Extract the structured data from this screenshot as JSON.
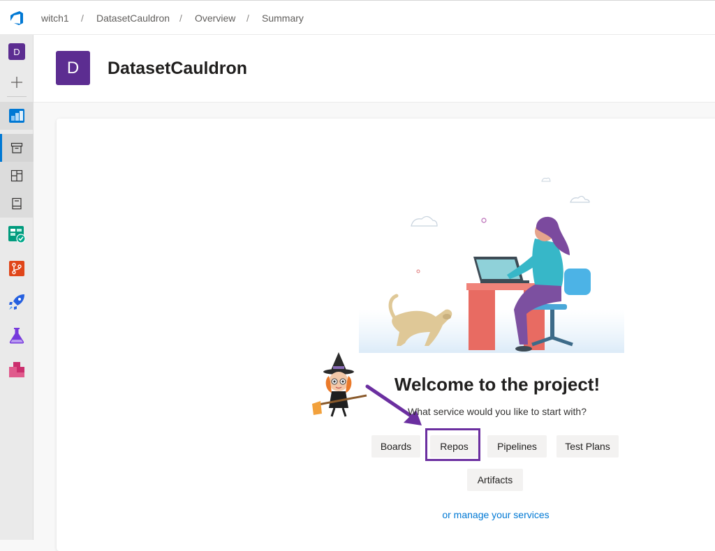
{
  "breadcrumb": {
    "items": [
      "witch1",
      "DatasetCauldron",
      "Overview",
      "Summary"
    ],
    "separator": "/"
  },
  "rail": {
    "project_initial": "D",
    "items": [
      {
        "name": "new",
        "icon": "plus-icon"
      },
      {
        "name": "overview",
        "icon": "overview-icon"
      },
      {
        "name": "summary",
        "icon": "summary-icon"
      },
      {
        "name": "dashboards",
        "icon": "dashboards-icon"
      },
      {
        "name": "wiki",
        "icon": "wiki-icon"
      },
      {
        "name": "boards",
        "icon": "boards-icon"
      },
      {
        "name": "repos",
        "icon": "repos-icon"
      },
      {
        "name": "pipelines",
        "icon": "pipelines-icon"
      },
      {
        "name": "test-plans",
        "icon": "test-plans-icon"
      },
      {
        "name": "artifacts",
        "icon": "artifacts-icon"
      }
    ]
  },
  "project": {
    "initial": "D",
    "name": "DatasetCauldron"
  },
  "welcome": {
    "title": "Welcome to the project!",
    "subtitle": "What service would you like to start with?",
    "services": [
      "Boards",
      "Repos",
      "Pipelines",
      "Test Plans",
      "Artifacts"
    ],
    "highlighted_service": "Repos",
    "manage_link": "or manage your services"
  },
  "colors": {
    "accent": "#0078d4",
    "project_avatar": "#5c2d91",
    "highlight": "#6b2fa0"
  }
}
